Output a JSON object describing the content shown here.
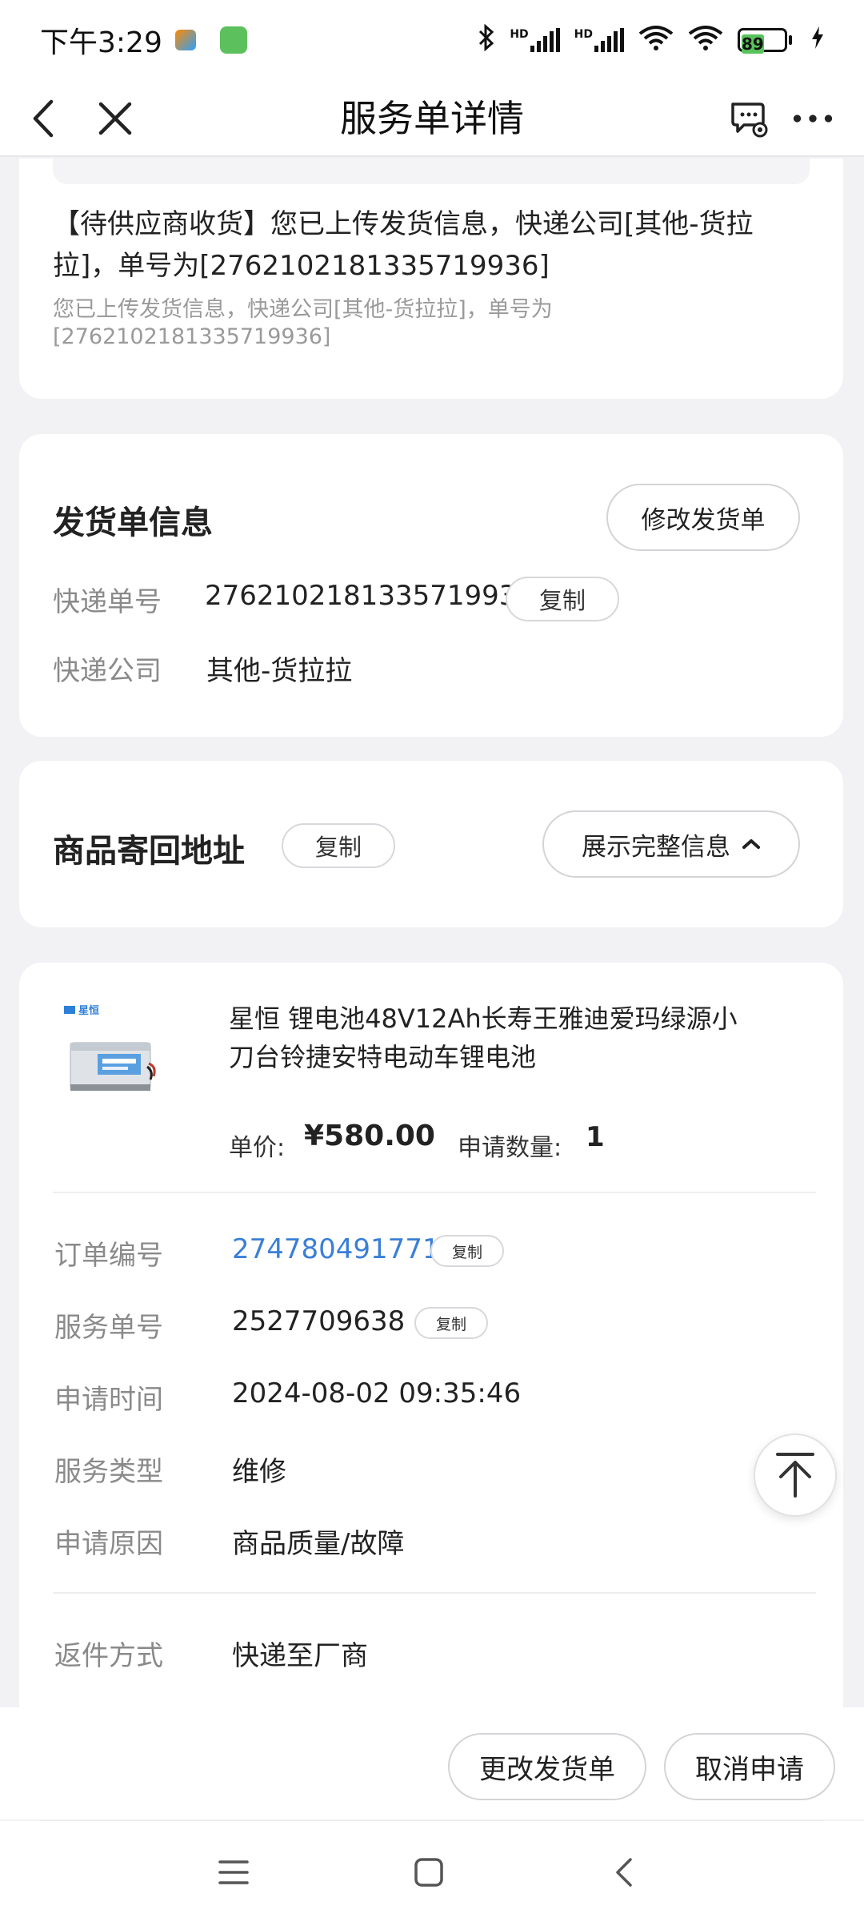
{
  "status_bar": {
    "time": "下午3:29",
    "network_label_1": "HD",
    "network_label_2": "HD",
    "battery": "89"
  },
  "header": {
    "title": "服务单详情"
  },
  "status_card": {
    "main_text": "【待供应商收货】您已上传发货信息，快递公司[其他-货拉拉]，单号为[2762102181335719936]",
    "sub_text": "您已上传发货信息，快递公司[其他-货拉拉]，单号为[2762102181335719936]"
  },
  "shipment": {
    "title": "发货单信息",
    "modify_button": "修改发货单",
    "tracking_label": "快递单号",
    "tracking_value": "2762102181335719936",
    "copy_label": "复制",
    "company_label": "快递公司",
    "company_value": "其他-货拉拉"
  },
  "return_address": {
    "title": "商品寄回地址",
    "copy_label": "复制",
    "expand_button": "展示完整信息"
  },
  "product": {
    "brand_logo_text": "星恒",
    "name": "星恒 锂电池48V12Ah长寿王雅迪爱玛绿源小刀台铃捷安特电动车锂电池",
    "price_label": "单价:",
    "price_value": "¥580.00",
    "qty_label": "申请数量:",
    "qty_value": "1"
  },
  "order": {
    "order_no_label": "订单编号",
    "order_no_value": "274780491771",
    "service_no_label": "服务单号",
    "service_no_value": "2527709638",
    "copy_label": "复制",
    "apply_time_label": "申请时间",
    "apply_time_value": "2024-08-02 09:35:46",
    "service_type_label": "服务类型",
    "service_type_value": "维修",
    "reason_label": "申请原因",
    "reason_value": "商品质量/故障",
    "return_method_label": "返件方式",
    "return_method_value": "快递至厂商"
  },
  "actions": {
    "change_shipment": "更改发货单",
    "cancel_request": "取消申请"
  },
  "colors": {
    "link": "#3a7fd8",
    "background": "#f2f2f4",
    "card": "#ffffff",
    "battery": "#57c35a"
  }
}
